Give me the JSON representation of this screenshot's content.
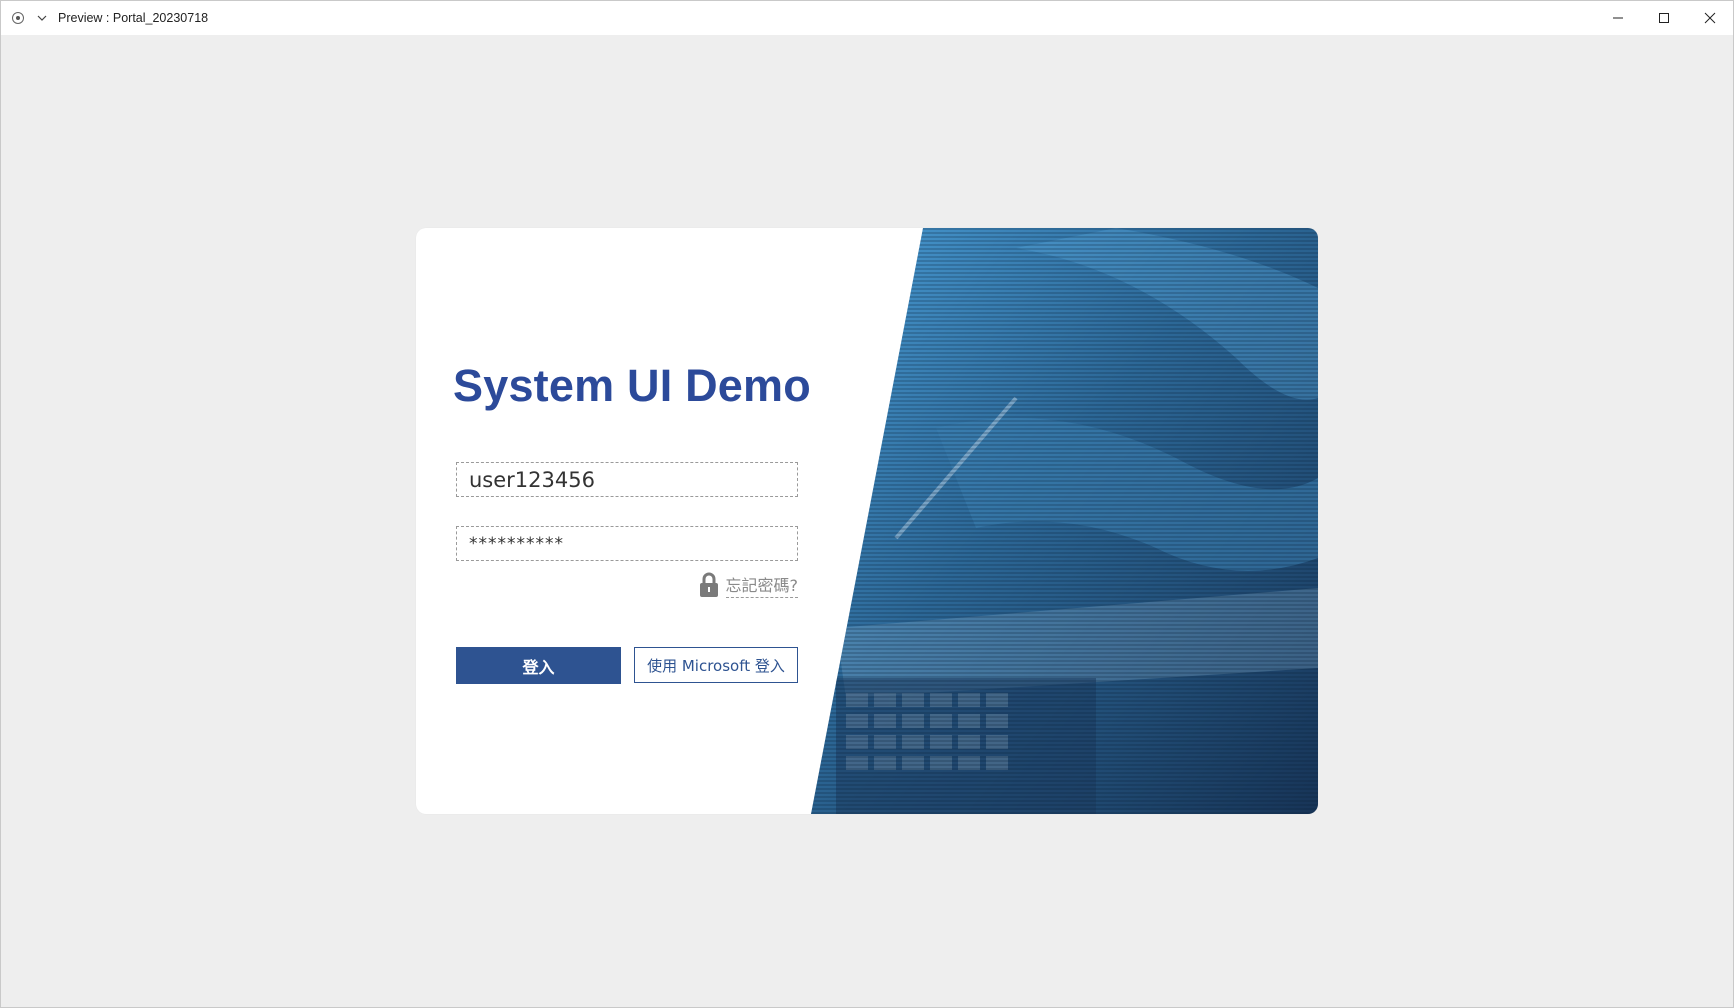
{
  "window": {
    "title": "Preview : Portal_20230718"
  },
  "login": {
    "title": "System UI Demo",
    "username_value": "user123456",
    "password_value": "**********",
    "forgot_label": "忘記密碼?",
    "login_label": "登入",
    "microsoft_label": "使用 Microsoft 登入"
  },
  "colors": {
    "accent": "#2e5391",
    "title": "#2c4a9a",
    "hero_light": "#4a9dd6",
    "hero_dark": "#173457"
  },
  "icons": {
    "lock": "lock-icon",
    "minimize": "minimize-icon",
    "maximize": "maximize-icon",
    "close": "close-icon"
  }
}
